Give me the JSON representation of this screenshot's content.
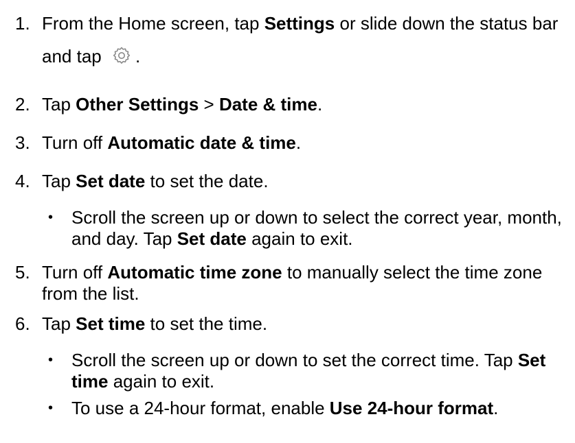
{
  "steps": [
    {
      "num": "1.",
      "pre": "From the Home screen, tap ",
      "bold1": "Settings",
      "mid": " or slide down the status bar and tap ",
      "icon": "gear-icon",
      "post": "."
    },
    {
      "num": "2.",
      "pre": "Tap ",
      "bold1": "Other Settings",
      "mid": " > ",
      "bold2": "Date & time",
      "post": "."
    },
    {
      "num": "3.",
      "pre": "Turn off ",
      "bold1": "Automatic date & time",
      "post": "."
    },
    {
      "num": "4.",
      "pre": "Tap ",
      "bold1": "Set date",
      "post": " to set the date.",
      "sub": [
        {
          "bullet": "•",
          "pre": "Scroll the screen up or down to select the correct year, month, and day. Tap ",
          "bold": "Set date",
          "post": " again to exit."
        }
      ]
    },
    {
      "num": "5.",
      "pre": "Turn off ",
      "bold1": "Automatic time zone",
      "post": " to manually select the time zone from the list."
    },
    {
      "num": "6.",
      "pre": "Tap ",
      "bold1": "Set time",
      "post": " to set the time.",
      "sub": [
        {
          "bullet": "•",
          "pre": "Scroll the screen up or down to set the correct time. Tap ",
          "bold": "Set time",
          "post": " again to exit."
        },
        {
          "bullet": "•",
          "pre": "To use a 24-hour format, enable ",
          "bold": "Use 24-hour format",
          "post": "."
        }
      ]
    }
  ],
  "colors": {
    "text": "#000000",
    "icon": "#8a8a8a",
    "background": "#ffffff"
  }
}
